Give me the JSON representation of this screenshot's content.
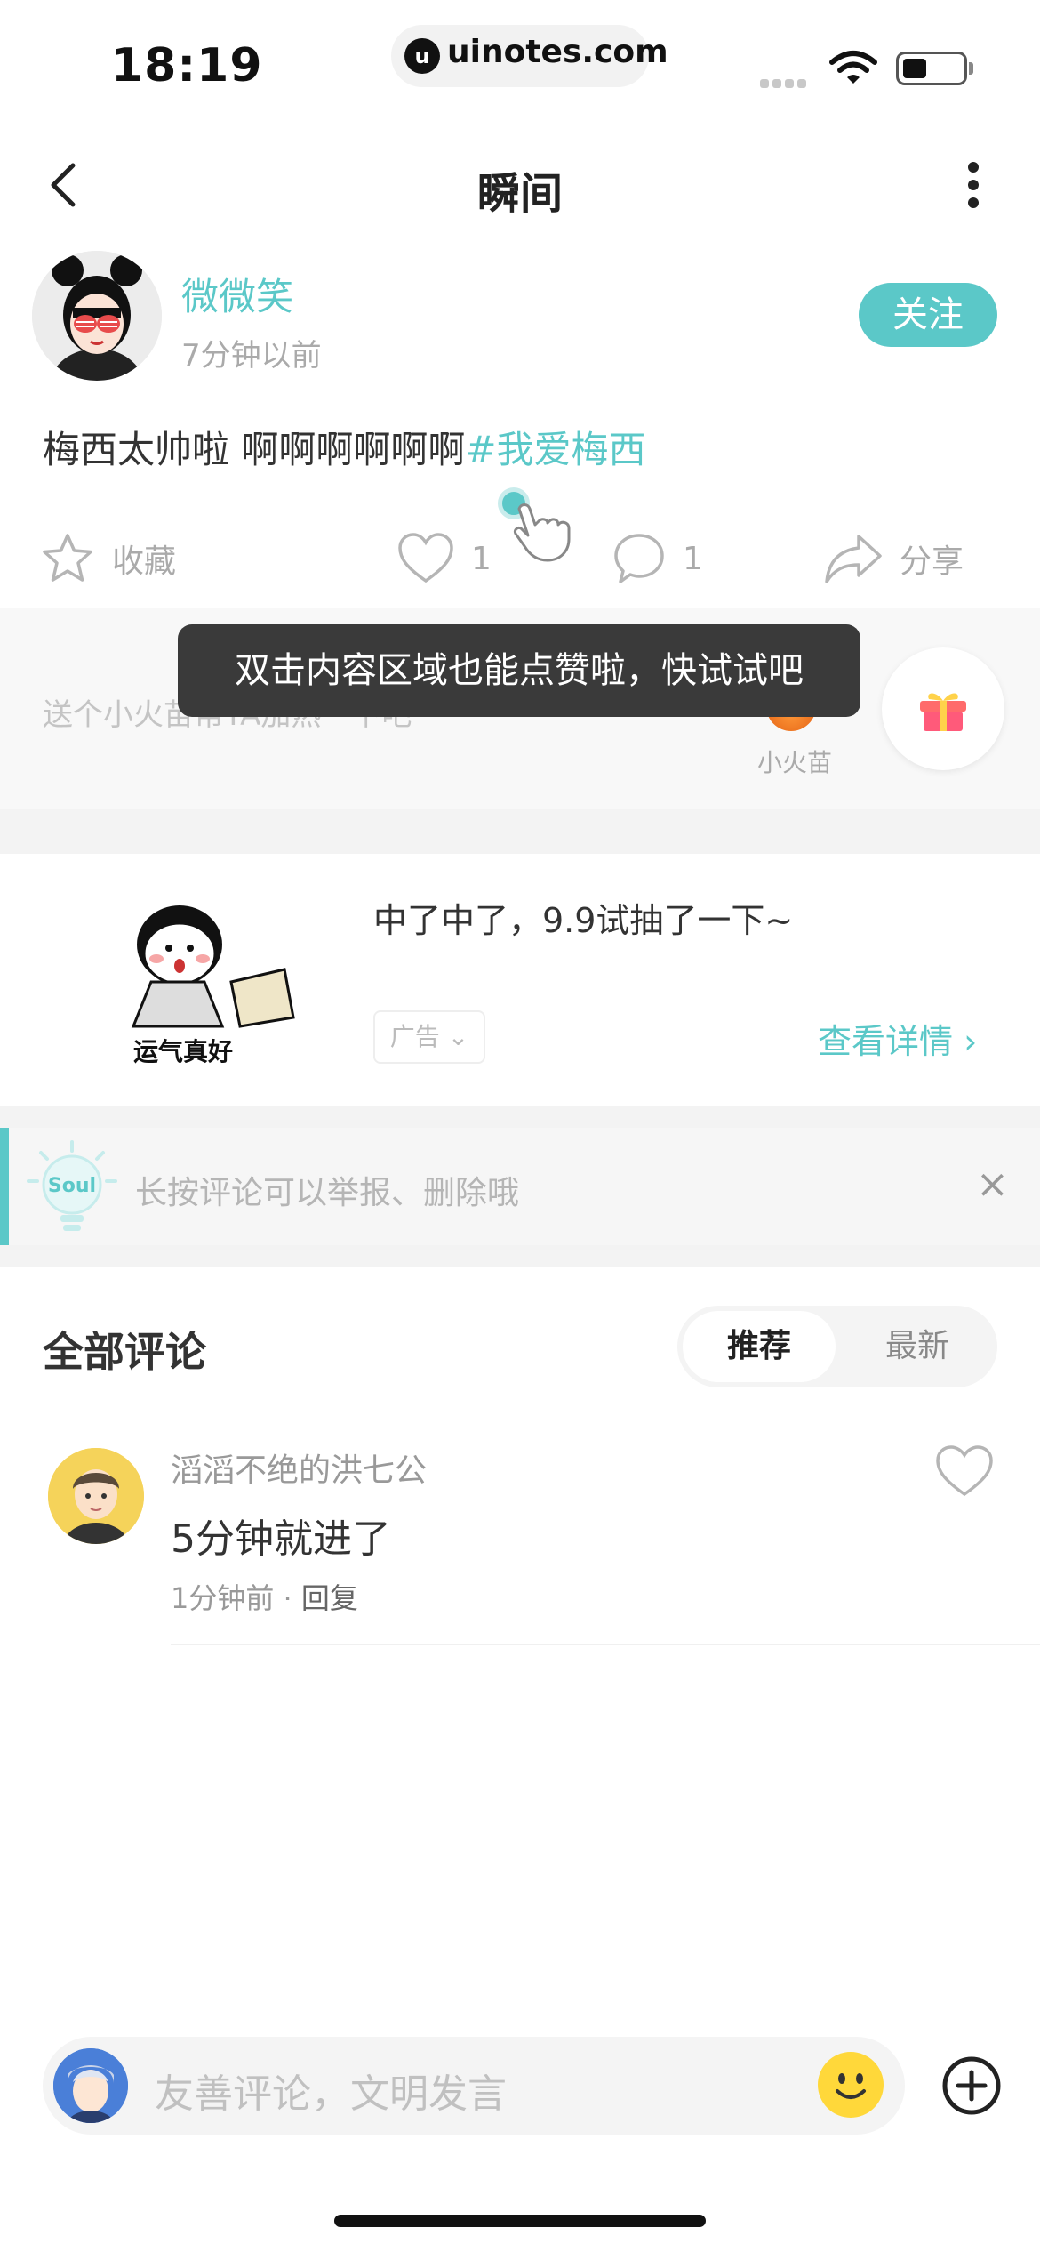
{
  "status_bar": {
    "time": "18:19",
    "url": "uinotes.com",
    "url_logo": "u"
  },
  "nav": {
    "title": "瞬间"
  },
  "post": {
    "author_name": "微微笑",
    "time_ago": "7分钟以前",
    "follow_label": "关注",
    "text": "梅西太帅啦 啊啊啊啊啊啊",
    "hashtag": "#我爱梅西",
    "actions": {
      "collect_label": "收藏",
      "like_count": "1",
      "comment_count": "1",
      "share_label": "分享"
    }
  },
  "gift": {
    "prompt": "送个小火苗帮TA加热一下吧",
    "fire_label": "小火苗"
  },
  "tooltip": {
    "text": "双击内容区域也能点赞啦，快试试吧"
  },
  "ad": {
    "title": "中了中了，9.9试抽了一下~",
    "image_caption": "运气真好",
    "tag_label": "广告",
    "detail_label": "查看详情"
  },
  "tip": {
    "bulb_text": "Soul",
    "text": "长按评论可以举报、删除哦",
    "close": "×"
  },
  "comments": {
    "title": "全部评论",
    "sort_options": [
      "推荐",
      "最新"
    ],
    "selected_sort": "推荐",
    "items": [
      {
        "user": "滔滔不绝的洪七公",
        "body": "5分钟就进了",
        "time": "1分钟前",
        "reply_label": "回复"
      }
    ]
  },
  "bottom_bar": {
    "placeholder": "友善评论，文明发言"
  },
  "colors": {
    "accent": "#5bc8c8",
    "tooltip_bg": "#3a3a3a",
    "separator": "#f3f3f3"
  },
  "icons": {
    "back": "chevron-left-icon",
    "more": "more-vertical-icon",
    "collect": "star-icon",
    "like": "heart-icon",
    "comment": "comment-bubble-icon",
    "share": "share-arrow-icon",
    "gift": "gift-icon",
    "fire": "fire-icon",
    "close": "close-icon",
    "emoji": "smiley-icon",
    "plus": "plus-circle-icon"
  }
}
